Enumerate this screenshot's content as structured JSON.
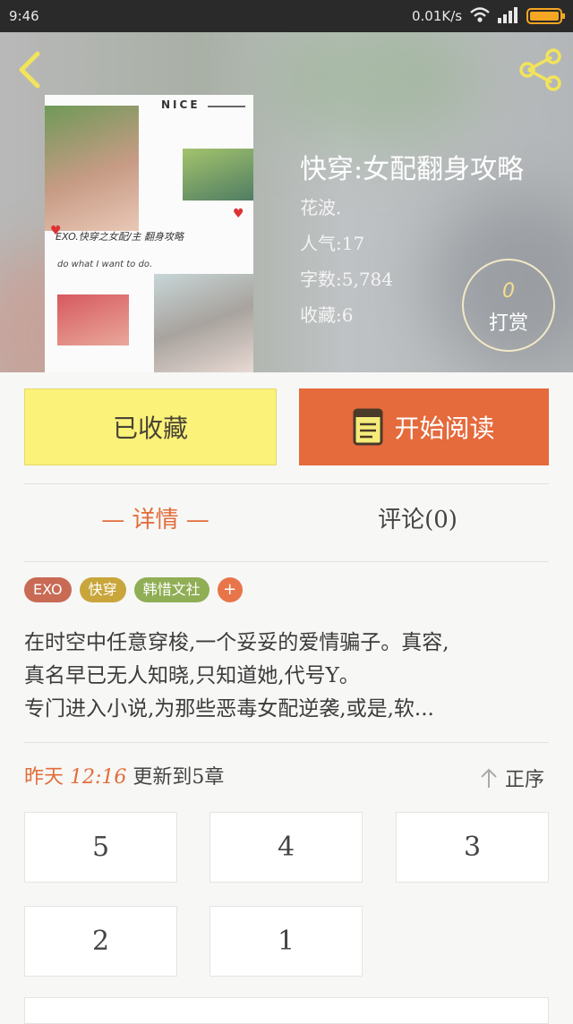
{
  "status_bar": {
    "time": "9:46",
    "net_speed": "0.01K/s",
    "battery_color": "#f5a623"
  },
  "header": {
    "back_icon": "back-icon",
    "share_icon": "share-icon",
    "accent": "#f2e45a"
  },
  "cover": {
    "nice_text": "NICE",
    "caption1": "EXO.快穿之女配/主 翻身攻略",
    "caption2": "do what I want to do."
  },
  "book": {
    "title": "快穿:女配翻身攻略",
    "author": "花波.",
    "popularity": "人气:17",
    "word_count": "字数:5,784",
    "favorites": "收藏:6"
  },
  "reward": {
    "count": "0",
    "label": "打赏"
  },
  "actions": {
    "collected_label": "已收藏",
    "read_label": "开始阅读",
    "collected_color": "#fbf27a",
    "read_color": "#e56a3c"
  },
  "tabs": {
    "detail_label": "— 详情 —",
    "comments_label": "评论(0)"
  },
  "tags": [
    {
      "label": "EXO",
      "color": "#c86a54"
    },
    {
      "label": "快穿",
      "color": "#c9a63b"
    },
    {
      "label": "韩惜文社",
      "color": "#8fae55"
    }
  ],
  "tag_add_label": "+",
  "synopsis": [
    "在时空中任意穿梭,一个妥妥的爱情骗子。真容,",
    "真名早已无人知晓,只知道她,代号Y。",
    "专门进入小说,为那些恶毒女配逆袭,或是,软..."
  ],
  "update": {
    "day": "昨天",
    "time": "12:16",
    "text": "更新到5章"
  },
  "order_label": "正序",
  "chapters": [
    "5",
    "4",
    "3",
    "2",
    "1"
  ]
}
